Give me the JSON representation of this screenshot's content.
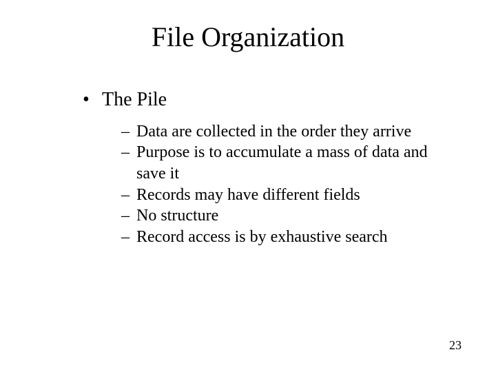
{
  "title": "File Organization",
  "bullet": {
    "glyph": "•",
    "label": "The Pile"
  },
  "subitems": [
    "Data are collected in the order they arrive",
    "Purpose is to accumulate a mass of data and save it",
    "Records may have different fields",
    "No structure",
    "Record access is by exhaustive search"
  ],
  "dash": "–",
  "page_number": "23"
}
